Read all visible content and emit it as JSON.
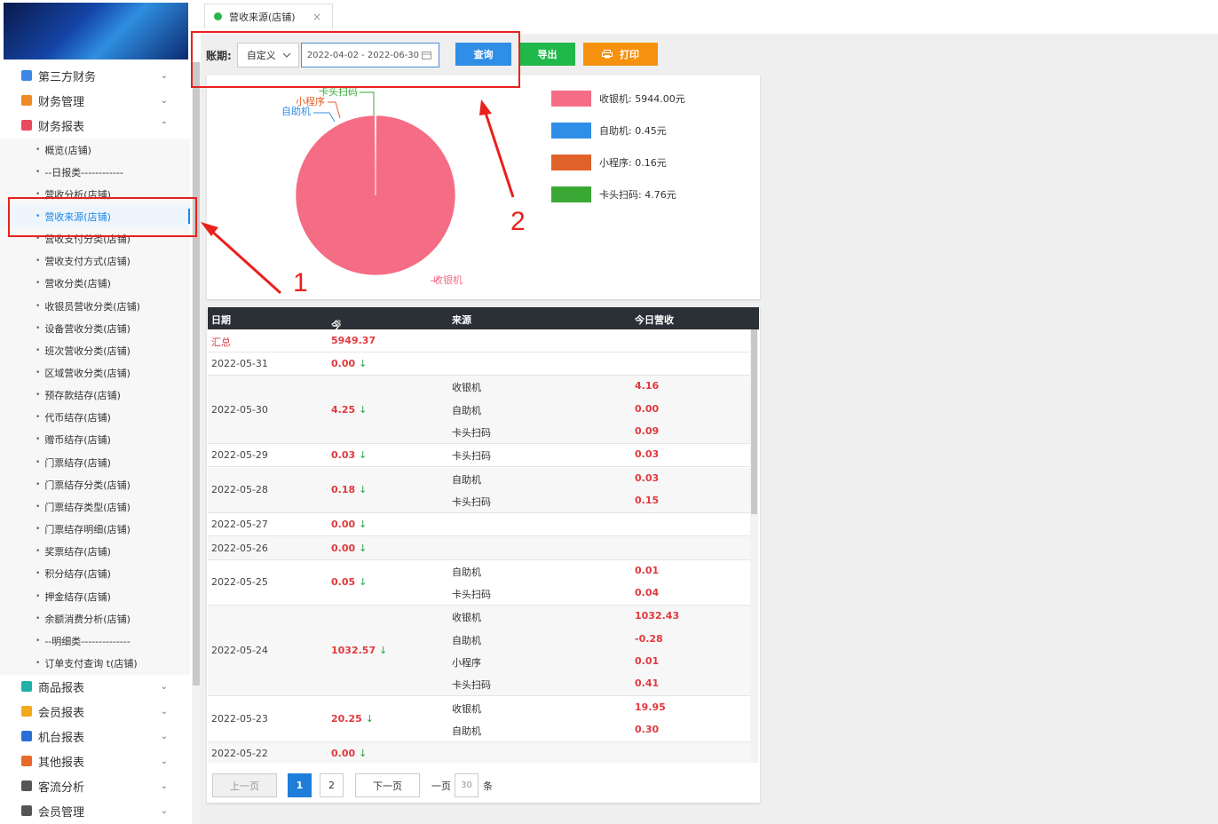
{
  "sidebar": {
    "groups": [
      {
        "label": "第三方财务",
        "color": "#3b87e6",
        "chev": "⌄"
      },
      {
        "label": "财务管理",
        "color": "#f08a24",
        "chev": "⌄"
      },
      {
        "label": "财务报表",
        "color": "#e84a5f",
        "chev": "⌃"
      },
      {
        "label": "商品报表",
        "color": "#20b0a8",
        "chev": "⌄"
      },
      {
        "label": "会员报表",
        "color": "#f3a81e",
        "chev": "⌄"
      },
      {
        "label": "机台报表",
        "color": "#2a6fd6",
        "chev": "⌄"
      },
      {
        "label": "其他报表",
        "color": "#e86a2a",
        "chev": "⌄"
      },
      {
        "label": "客流分析",
        "color": "#555555",
        "chev": "⌄"
      },
      {
        "label": "会员管理",
        "color": "#555555",
        "chev": "⌄"
      }
    ],
    "items": [
      "概览(店铺)",
      "--日报类------------",
      "营收分析(店铺)",
      "营收来源(店铺)",
      "营收支付分类(店铺)",
      "营收支付方式(店铺)",
      "营收分类(店铺)",
      "收银员营收分类(店铺)",
      "设备营收分类(店铺)",
      "班次营收分类(店铺)",
      "区域营收分类(店铺)",
      "预存款结存(店铺)",
      "代币结存(店铺)",
      "赠币结存(店铺)",
      "门票结存(店铺)",
      "门票结存分类(店铺)",
      "门票结存类型(店铺)",
      "门票结存明细(店铺)",
      "奖票结存(店铺)",
      "积分结存(店铺)",
      "押金结存(店铺)",
      "余额消费分析(店铺)",
      "--明细类--------------",
      "订单支付查询 t(店铺)"
    ],
    "bullet": "•"
  },
  "tab": {
    "label": "营收来源(店铺)",
    "close": "×"
  },
  "filter": {
    "period_label": "账期:",
    "period_value": "自定义",
    "date_range": "2022-04-02 - 2022-06-30",
    "query": "查询",
    "export": "导出",
    "print": "打印"
  },
  "callouts": {
    "one": "1",
    "two": "2"
  },
  "chart_data": {
    "type": "pie",
    "slices": [
      {
        "name": "收银机",
        "value": 5944.0,
        "color": "#f56d84",
        "legend": "收银机: 5944.00元"
      },
      {
        "name": "自助机",
        "value": 0.45,
        "color": "#2f8ee6",
        "legend": "自助机: 0.45元"
      },
      {
        "name": "小程序",
        "value": 0.16,
        "color": "#e0622a",
        "legend": "小程序: 0.16元"
      },
      {
        "name": "卡头扫码",
        "value": 4.76,
        "color": "#3aa835",
        "legend": "卡头扫码: 4.76元"
      }
    ],
    "legend_position": "right"
  },
  "table": {
    "headers": {
      "date": "日期",
      "total": "今日总营收",
      "sort": "⇕",
      "source": "来源",
      "amount": "今日营收"
    },
    "summary": {
      "label": "汇总",
      "total": "5949.37"
    },
    "arrow": "↓",
    "rows": [
      {
        "date": "2022-05-31",
        "total": "0.00",
        "subs": []
      },
      {
        "date": "2022-05-30",
        "total": "4.25",
        "subs": [
          {
            "src": "收银机",
            "amt": "4.16"
          },
          {
            "src": "自助机",
            "amt": "0.00"
          },
          {
            "src": "卡头扫码",
            "amt": "0.09"
          }
        ]
      },
      {
        "date": "2022-05-29",
        "total": "0.03",
        "subs": [
          {
            "src": "卡头扫码",
            "amt": "0.03"
          }
        ]
      },
      {
        "date": "2022-05-28",
        "total": "0.18",
        "subs": [
          {
            "src": "自助机",
            "amt": "0.03"
          },
          {
            "src": "卡头扫码",
            "amt": "0.15"
          }
        ]
      },
      {
        "date": "2022-05-27",
        "total": "0.00",
        "subs": []
      },
      {
        "date": "2022-05-26",
        "total": "0.00",
        "subs": []
      },
      {
        "date": "2022-05-25",
        "total": "0.05",
        "subs": [
          {
            "src": "自助机",
            "amt": "0.01"
          },
          {
            "src": "卡头扫码",
            "amt": "0.04"
          }
        ]
      },
      {
        "date": "2022-05-24",
        "total": "1032.57",
        "subs": [
          {
            "src": "收银机",
            "amt": "1032.43"
          },
          {
            "src": "自助机",
            "amt": "-0.28"
          },
          {
            "src": "小程序",
            "amt": "0.01"
          },
          {
            "src": "卡头扫码",
            "amt": "0.41"
          }
        ]
      },
      {
        "date": "2022-05-23",
        "total": "20.25",
        "subs": [
          {
            "src": "收银机",
            "amt": "19.95"
          },
          {
            "src": "自助机",
            "amt": "0.30"
          }
        ]
      },
      {
        "date": "2022-05-22",
        "total": "0.00",
        "subs": []
      }
    ]
  },
  "pager": {
    "prev": "上一页",
    "pages": [
      "1",
      "2"
    ],
    "current": "1",
    "next": "下一页",
    "per_page_label": "一页",
    "per_page": "30",
    "unit": "条"
  }
}
